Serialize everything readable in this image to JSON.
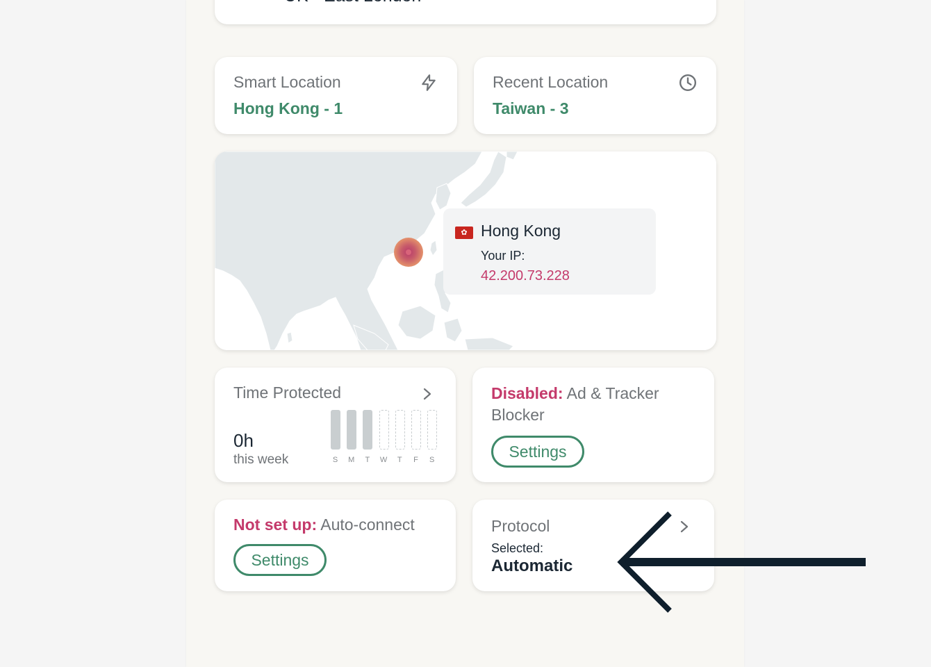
{
  "top_card": {
    "location": "UK - East London",
    "flag_icon": "uk-flag-icon"
  },
  "smart_location": {
    "label": "Smart Location",
    "value": "Hong Kong - 1",
    "icon": "lightning-icon"
  },
  "recent_location": {
    "label": "Recent Location",
    "value": "Taiwan - 3",
    "icon": "clock-icon"
  },
  "map": {
    "country": "Hong Kong",
    "flag_icon": "hong-kong-flag-icon",
    "ip_label": "Your IP:",
    "ip": "42.200.73.228"
  },
  "time_protected": {
    "title": "Time Protected",
    "value": "0h",
    "subtitle": "this week",
    "days": [
      "S",
      "M",
      "T",
      "W",
      "T",
      "F",
      "S"
    ],
    "filled_days": [
      true,
      true,
      true,
      false,
      false,
      false,
      false
    ]
  },
  "blocker": {
    "status": "Disabled:",
    "label": "Ad & Tracker Blocker",
    "button": "Settings"
  },
  "auto_connect": {
    "status": "Not set up:",
    "label": "Auto-connect",
    "button": "Settings"
  },
  "protocol": {
    "title": "Protocol",
    "selected_label": "Selected:",
    "selected_value": "Automatic"
  },
  "colors": {
    "accent_green": "#3f8a6a",
    "alert_pink": "#c43a6b",
    "arrow": "#0f1f2c"
  }
}
